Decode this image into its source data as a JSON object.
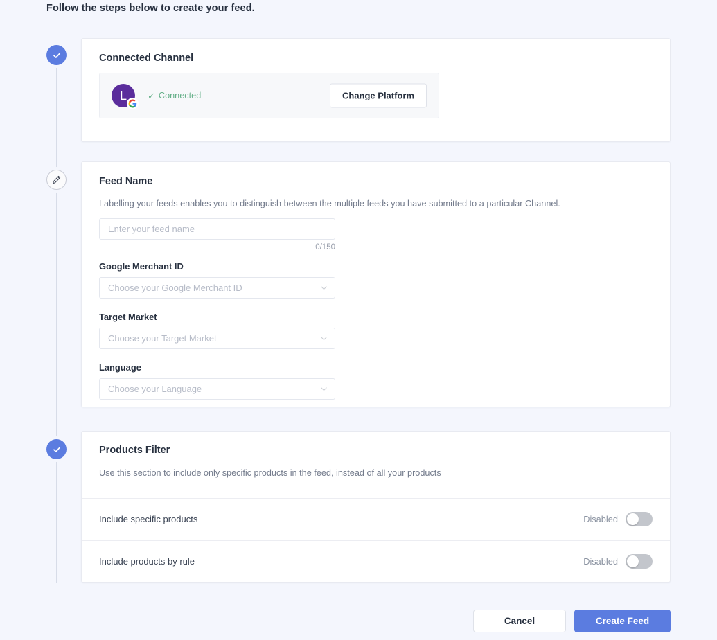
{
  "page": {
    "heading": "Follow the steps below to create your feed."
  },
  "theme": {
    "background": "#f4f6fd",
    "accent": "#5b7ce0",
    "success": "#66b089",
    "avatar": "#5b2d9c",
    "card_bg": "#ffffff",
    "panel_bg": "#f7f8fa"
  },
  "steps": [
    {
      "name": "connected-channel",
      "icon": "check-icon",
      "state": "done"
    },
    {
      "name": "feed-name",
      "icon": "pencil-icon",
      "state": "editing"
    },
    {
      "name": "products-filter",
      "icon": "check-icon",
      "state": "done"
    }
  ],
  "connected_channel": {
    "title": "Connected Channel",
    "avatar_letter": "L",
    "platform_badge": "google-icon",
    "status_text": "Connected",
    "status_icon": "check-icon",
    "change_button": "Change Platform"
  },
  "feed_name": {
    "title": "Feed Name",
    "description": "Labelling your feeds enables you to distinguish between the multiple feeds you have submitted to a particular Channel.",
    "input": {
      "value": "",
      "placeholder": "Enter your feed name",
      "counter": "0/150"
    },
    "fields": [
      {
        "label": "Google Merchant ID",
        "placeholder": "Choose your Google Merchant ID",
        "value": "",
        "icon": "chevron-down-icon"
      },
      {
        "label": "Target Market",
        "placeholder": "Choose your Target Market",
        "value": "",
        "icon": "chevron-down-icon"
      },
      {
        "label": "Language",
        "placeholder": "Choose your Language",
        "value": "",
        "icon": "chevron-down-icon"
      }
    ]
  },
  "products_filter": {
    "title": "Products Filter",
    "description": "Use this section to include only specific products in the feed, instead of all your products",
    "rows": [
      {
        "label": "Include specific products",
        "state_label": "Disabled",
        "enabled": false
      },
      {
        "label": "Include products by rule",
        "state_label": "Disabled",
        "enabled": false
      }
    ]
  },
  "footer": {
    "cancel_label": "Cancel",
    "create_label": "Create Feed"
  }
}
